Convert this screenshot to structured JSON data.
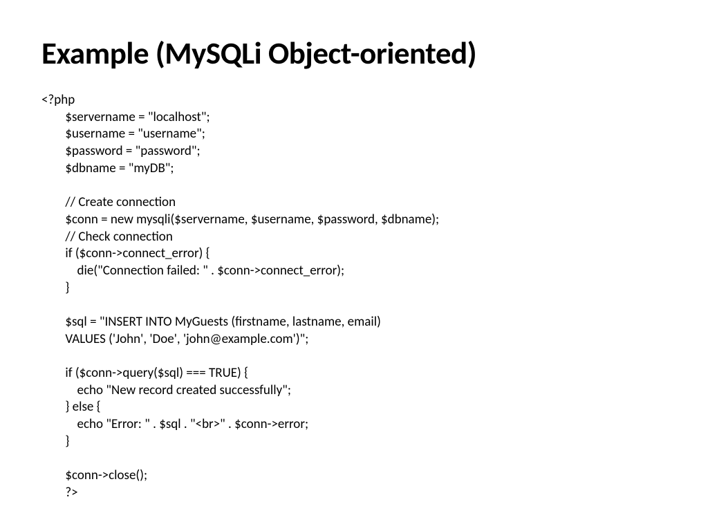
{
  "title": "Example (MySQLi Object-oriented)",
  "code": "<?php\n        $servername = \"localhost\";\n        $username = \"username\";\n        $password = \"password\";\n        $dbname = \"myDB\";\n\n        // Create connection\n        $conn = new mysqli($servername, $username, $password, $dbname);\n        // Check connection\n        if ($conn->connect_error) {\n            die(\"Connection failed: \" . $conn->connect_error);\n        }\n\n        $sql = \"INSERT INTO MyGuests (firstname, lastname, email)\n        VALUES ('John', 'Doe', 'john@example.com')\";\n\n        if ($conn->query($sql) === TRUE) {\n            echo \"New record created successfully\";\n        } else {\n            echo \"Error: \" . $sql . \"<br>\" . $conn->error;\n        }\n\n        $conn->close();\n        ?>"
}
